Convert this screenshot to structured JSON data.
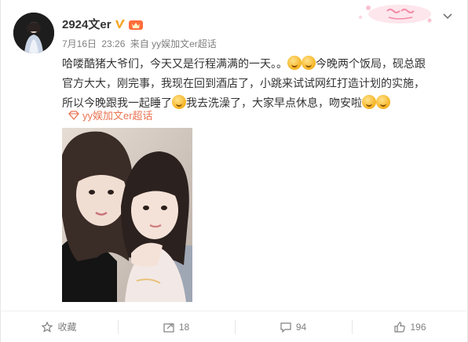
{
  "post": {
    "username": "2924文er",
    "date": "7月16日",
    "time": "23:26",
    "source_prefix": "来自",
    "source": "yy娱加文er超话",
    "text_parts": [
      "哈喽酷猪大爷们，今天又是行程满满的一天。。",
      "今晚两个饭局，砚总跟官方大大，刚完事，我现在回到酒店了，小跳来试试网红打造计划的实施，所以今晚跟我一起睡了",
      "我去洗澡了，大家早点休息，吻安啦"
    ],
    "topic": "yy娱加文er超话"
  },
  "actions": {
    "favorite_label": "收藏",
    "repost_count": "18",
    "comment_count": "94",
    "like_count": "196"
  },
  "icons": {
    "verified": "verified-v-icon",
    "vip": "vip-crown-icon",
    "chevron": "chevron-down-icon",
    "topic": "super-topic-icon",
    "favorite": "star-icon",
    "repost": "repost-icon",
    "comment": "comment-icon",
    "like": "thumbs-up-icon"
  },
  "colors": {
    "accent": "#eb7350",
    "verified": "#f5a623",
    "muted": "#808080"
  }
}
